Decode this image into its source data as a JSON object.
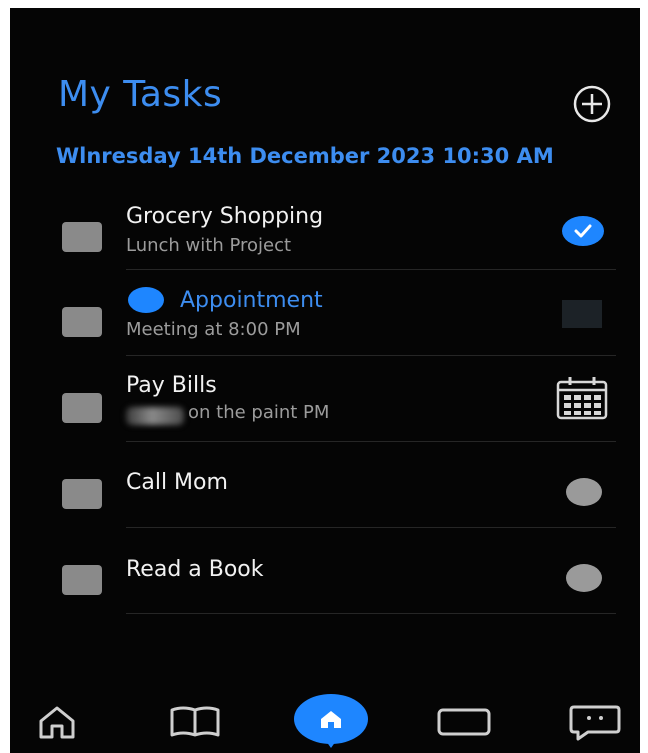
{
  "header": {
    "title": "My Tasks",
    "add_icon": "plus-circle-icon",
    "date": "Wlnresday 14th December 2023 10:30 AM"
  },
  "tasks": [
    {
      "title": "Grocery Shopping",
      "subtitle": "Lunch with Project",
      "status_icon": "checked-circle-icon",
      "checked": true
    },
    {
      "title": "Appointment",
      "subtitle": "Meeting at 8:00 PM",
      "leading_icon": "blue-dot-icon",
      "status_icon": "dark-square-icon"
    },
    {
      "title": "Pay Bills",
      "subtitle": "on the paint PM",
      "status_icon": "calendar-icon"
    },
    {
      "title": "Call Mom",
      "subtitle": "",
      "status_icon": "gray-dot-icon"
    },
    {
      "title": "Read a Book",
      "subtitle": "",
      "status_icon": "gray-dot-icon"
    }
  ],
  "bottom_nav": [
    {
      "icon": "home-outline-icon"
    },
    {
      "icon": "book-icon"
    },
    {
      "icon": "home-icon",
      "active": true
    },
    {
      "icon": "card-icon"
    },
    {
      "icon": "chat-icon"
    }
  ],
  "colors": {
    "background": "#050505",
    "accent": "#3d8df0",
    "check": "#1e86ff",
    "checkbox": "#8a8a8a",
    "text_primary": "#f2f2f2",
    "text_secondary": "#9c9c9c"
  }
}
